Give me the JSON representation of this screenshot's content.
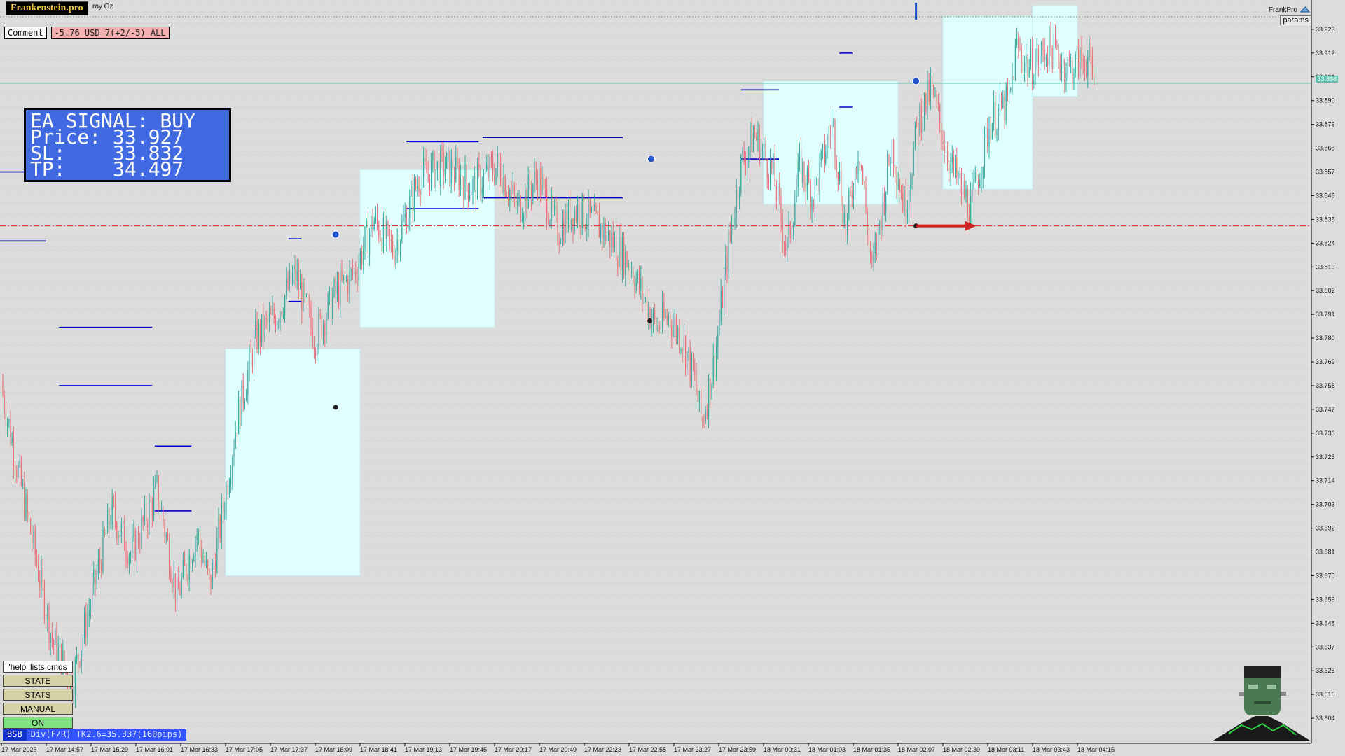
{
  "app": {
    "brand": "Frankenstein.pro",
    "symbol_note": "roy Oz",
    "right_label": "FrankPro",
    "params_button": "params",
    "current_price_tag": "33.898"
  },
  "comment": {
    "label": "Comment",
    "value": "-5.76 USD 7(+2/-5) ALL"
  },
  "signal": {
    "line1": "EA SIGNAL: BUY",
    "line2": "Price: 33.927",
    "line3": "SL:    33.832",
    "line4": "TP:    34.497"
  },
  "controls": {
    "help": "'help' lists cmds",
    "state": "STATE",
    "stats": "STATS",
    "manual": "MANUAL",
    "on": "ON"
  },
  "status": {
    "bsb": "BSB",
    "div": "Div(F/R) TK2.6=35.337(160pips)"
  },
  "colors": {
    "up_candle": "#3aa8a0",
    "down_candle": "#e57373",
    "zone_fill": "#e0ffff",
    "level_line": "#0000cc",
    "sl_line": "#d22",
    "current_price_line": "#5fbfae",
    "signal_bg": "#4169e1"
  },
  "chart_data": {
    "type": "candlestick",
    "y_ticks": [
      "33.923",
      "33.912",
      "33.901",
      "33.890",
      "33.879",
      "33.868",
      "33.857",
      "33.846",
      "33.835",
      "33.824",
      "33.813",
      "33.802",
      "33.791",
      "33.780",
      "33.769",
      "33.758",
      "33.747",
      "33.736",
      "33.725",
      "33.714",
      "33.703",
      "33.692",
      "33.681",
      "33.670",
      "33.659",
      "33.648",
      "33.637",
      "33.626",
      "33.615",
      "33.604"
    ],
    "x_ticks": [
      "17 Mar 2025",
      "17 Mar 14:57",
      "17 Mar 15:29",
      "17 Mar 16:01",
      "17 Mar 16:33",
      "17 Mar 17:05",
      "17 Mar 17:37",
      "17 Mar 18:09",
      "17 Mar 18:41",
      "17 Mar 19:13",
      "17 Mar 19:45",
      "17 Mar 20:17",
      "17 Mar 20:49",
      "17 Mar 22:23",
      "17 Mar 22:55",
      "17 Mar 23:27",
      "17 Mar 23:59",
      "18 Mar 00:31",
      "18 Mar 01:03",
      "18 Mar 01:35",
      "18 Mar 02:07",
      "18 Mar 02:39",
      "18 Mar 03:11",
      "18 Mar 03:43",
      "18 Mar 04:15"
    ],
    "ylim": [
      33.593,
      33.934
    ],
    "sl_level": 33.832,
    "current_price": 33.898,
    "close_path": [
      [
        0,
        33.76
      ],
      [
        0.02,
        33.7
      ],
      [
        0.04,
        33.64
      ],
      [
        0.055,
        33.62
      ],
      [
        0.07,
        33.66
      ],
      [
        0.085,
        33.7
      ],
      [
        0.1,
        33.68
      ],
      [
        0.12,
        33.71
      ],
      [
        0.135,
        33.66
      ],
      [
        0.15,
        33.69
      ],
      [
        0.16,
        33.665
      ],
      [
        0.17,
        33.7
      ],
      [
        0.18,
        33.74
      ],
      [
        0.195,
        33.78
      ],
      [
        0.21,
        33.79
      ],
      [
        0.225,
        33.81
      ],
      [
        0.24,
        33.78
      ],
      [
        0.255,
        33.8
      ],
      [
        0.27,
        33.81
      ],
      [
        0.285,
        33.835
      ],
      [
        0.3,
        33.82
      ],
      [
        0.32,
        33.855
      ],
      [
        0.34,
        33.86
      ],
      [
        0.36,
        33.85
      ],
      [
        0.38,
        33.86
      ],
      [
        0.395,
        33.84
      ],
      [
        0.41,
        33.855
      ],
      [
        0.425,
        33.83
      ],
      [
        0.44,
        33.84
      ],
      [
        0.46,
        33.83
      ],
      [
        0.48,
        33.815
      ],
      [
        0.49,
        33.8
      ],
      [
        0.5,
        33.785
      ],
      [
        0.51,
        33.79
      ],
      [
        0.52,
        33.78
      ],
      [
        0.53,
        33.76
      ],
      [
        0.535,
        33.74
      ],
      [
        0.545,
        33.77
      ],
      [
        0.555,
        33.82
      ],
      [
        0.565,
        33.86
      ],
      [
        0.575,
        33.875
      ],
      [
        0.59,
        33.855
      ],
      [
        0.6,
        33.82
      ],
      [
        0.61,
        33.86
      ],
      [
        0.62,
        33.845
      ],
      [
        0.635,
        33.88
      ],
      [
        0.645,
        33.83
      ],
      [
        0.655,
        33.87
      ],
      [
        0.665,
        33.81
      ],
      [
        0.68,
        33.87
      ],
      [
        0.69,
        33.84
      ],
      [
        0.7,
        33.88
      ],
      [
        0.71,
        33.895
      ],
      [
        0.725,
        33.86
      ],
      [
        0.74,
        33.84
      ],
      [
        0.755,
        33.88
      ],
      [
        0.77,
        33.89
      ],
      [
        0.775,
        33.915
      ],
      [
        0.785,
        33.905
      ],
      [
        0.8,
        33.915
      ],
      [
        0.815,
        33.905
      ],
      [
        0.83,
        33.91
      ],
      [
        0.835,
        33.895
      ]
    ],
    "zones": [
      {
        "from_time": "17 Mar 17:05",
        "to_time": "17 Mar 18:41",
        "low": 33.67,
        "high": 33.775
      },
      {
        "from_time": "17 Mar 18:41",
        "to_time": "17 Mar 20:17",
        "low": 33.785,
        "high": 33.858
      },
      {
        "from_time": "18 Mar 00:31",
        "to_time": "18 Mar 02:07",
        "low": 33.842,
        "high": 33.899
      },
      {
        "from_time": "18 Mar 02:39",
        "to_time": "18 Mar 03:43",
        "low": 33.849,
        "high": 33.929
      },
      {
        "from_time": "18 Mar 03:43",
        "to_time": "18 Mar 04:15",
        "low": 33.892,
        "high": 33.934
      }
    ]
  }
}
